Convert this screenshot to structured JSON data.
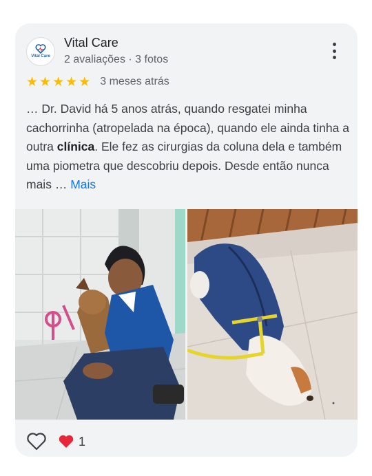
{
  "review": {
    "author": "Vital Care",
    "author_logo_text": "Vital Care",
    "meta": "2 avaliações · 3 fotos",
    "stars": 5,
    "time": "3 meses atrás",
    "text_part1": "… Dr. David há 5 anos atrás, quando resgatei minha cachorrinha (atropelada na época), quando ele ainda tinha a outra ",
    "text_bold": "clínica",
    "text_part2": ". Ele fez as cirurgias da coluna dela e também uma piometra que descobriu depois. Desde então nunca mais ",
    "ellipsis": "… ",
    "more_link": "Mais",
    "reactions_count": "1"
  },
  "colors": {
    "star": "#fbbc04",
    "link": "#1a73e8",
    "heart": "#e8263a",
    "card_bg": "#f1f3f4"
  },
  "icons": [
    "more-vert-icon",
    "star-icon",
    "heart-outline-icon",
    "heart-filled-icon"
  ]
}
